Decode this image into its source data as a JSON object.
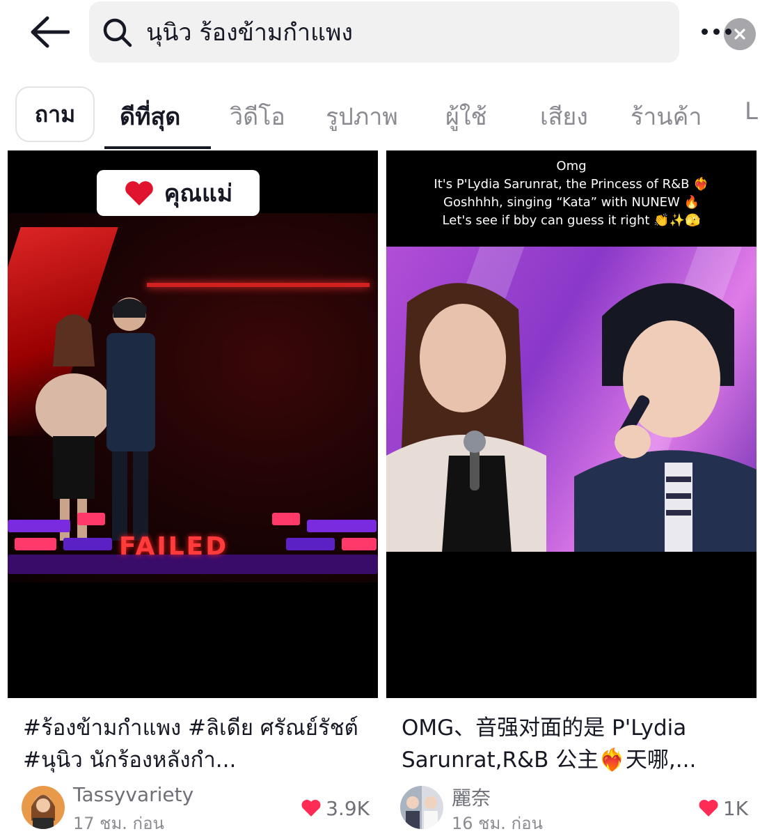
{
  "search": {
    "query": "นุนิว ร้องข้ามกำแพง"
  },
  "tabs": {
    "ask_label": "ถาม",
    "items": [
      {
        "label": "ดีที่สุด",
        "active": true
      },
      {
        "label": "วิดีโอ",
        "active": false
      },
      {
        "label": "รูปภาพ",
        "active": false
      },
      {
        "label": "ผู้ใช้",
        "active": false
      },
      {
        "label": "เสียง",
        "active": false
      },
      {
        "label": "ร้านค้า",
        "active": false
      },
      {
        "label": "L",
        "active": false
      }
    ]
  },
  "results": [
    {
      "thumbnail": {
        "sticker_text": "คุณแม่",
        "stage_text": "FAILED"
      },
      "caption": "#ร้องข้ามกำแพง #ลิเดีย ศรัณย์รัชต์ #นุนิว นักร้องหลังกำ...",
      "username": "Tassyvariety",
      "time": "17 ชม. ก่อน",
      "likes": "3.9K"
    },
    {
      "thumbnail": {
        "overlay_lines": [
          "Omg",
          "It's P'Lydia Sarunrat, the Princess of R&B ❤️‍🔥",
          "Goshhhh, singing “Kata” with NUNEW 🔥",
          "Let's see if bby can guess it right 👏✨🫣"
        ]
      },
      "caption": "OMG、音强对面的是 P'Lydia Sarunrat,R&B 公主❤️‍🔥天哪,...",
      "username": "麗奈",
      "time": "16 ชม. ก่อน",
      "likes": "1K"
    }
  ],
  "colors": {
    "heart": "#fe2c55",
    "text_primary": "#161823",
    "text_secondary": "#8a8b91",
    "search_bg": "#f1f1f2"
  }
}
